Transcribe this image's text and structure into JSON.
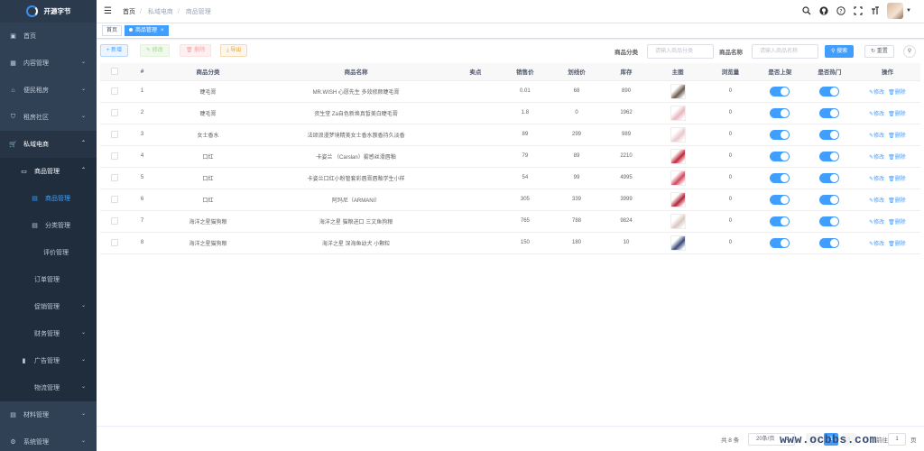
{
  "app": {
    "name": "开源字节"
  },
  "sidebar": {
    "items": [
      {
        "label": "首页",
        "icon": "dashboard-icon"
      },
      {
        "label": "内容管理",
        "icon": "grid-icon"
      },
      {
        "label": "便民租房",
        "icon": "home-icon"
      },
      {
        "label": "租房社区",
        "icon": "shield-icon"
      },
      {
        "label": "私域电商",
        "icon": "cart-icon"
      },
      {
        "label": "商品管理",
        "icon": "monitor-icon"
      },
      {
        "label": "商品管理",
        "icon": "table-icon"
      },
      {
        "label": "分类管理",
        "icon": "table-icon"
      },
      {
        "label": "评价管理",
        "icon": ""
      },
      {
        "label": "订单管理",
        "icon": ""
      },
      {
        "label": "促销管理",
        "icon": ""
      },
      {
        "label": "财务管理",
        "icon": ""
      },
      {
        "label": "广告管理",
        "icon": "bar-chart-icon"
      },
      {
        "label": "物流管理",
        "icon": ""
      },
      {
        "label": "材料管理",
        "icon": "doc-icon"
      },
      {
        "label": "系统管理",
        "icon": "gear-icon"
      }
    ]
  },
  "breadcrumb": [
    "首页",
    "私域电商",
    "商品管理"
  ],
  "tags": [
    {
      "label": "首页"
    },
    {
      "label": "商品管理"
    }
  ],
  "toolbar": {
    "add": "+ 新增",
    "edit": "✎ 修改",
    "delete": "🗑 删除",
    "export": "⤓ 导出"
  },
  "filters": {
    "category_label": "商品分类",
    "category_placeholder": "请输入商品分类",
    "name_label": "商品名称",
    "name_placeholder": "请输入商品名称",
    "search": "搜索",
    "reset": "重置"
  },
  "table": {
    "headers": [
      "",
      "#",
      "商品分类",
      "商品名称",
      "卖点",
      "销售价",
      "划线价",
      "库存",
      "主图",
      "浏览量",
      "是否上架",
      "是否热门",
      "操作"
    ],
    "rows": [
      {
        "idx": "1",
        "category": "睫毛膏",
        "name": "MR.WISH 心愿先生 多效修颜睫毛膏",
        "sell": "",
        "price": "0.01",
        "line_price": "68",
        "stock": "890",
        "views": "0",
        "on_sale": true,
        "hot": true,
        "thumb": "#6b5a4e"
      },
      {
        "idx": "2",
        "category": "睫毛膏",
        "name": "资生堂 Za自色新焕真皙美白睫毛膏",
        "sell": "",
        "price": "1.8",
        "line_price": "0",
        "stock": "1962",
        "views": "0",
        "on_sale": true,
        "hot": true,
        "thumb": "#e8b7c0"
      },
      {
        "idx": "3",
        "category": "女士香水",
        "name": "法颂浪漫梦境精美女士香水簇香持久淡香",
        "sell": "",
        "price": "89",
        "line_price": "299",
        "stock": "989",
        "views": "0",
        "on_sale": true,
        "hot": true,
        "thumb": "#e9c9cf"
      },
      {
        "idx": "4",
        "category": "口红",
        "name": "卡姿兰 （Carslan）雾感丝滑唇釉",
        "sell": "",
        "price": "79",
        "line_price": "89",
        "stock": "2210",
        "views": "0",
        "on_sale": true,
        "hot": true,
        "thumb": "#c0283a"
      },
      {
        "idx": "5",
        "category": "口红",
        "name": "卡姿兰口红小粉管套彩唇膏唇釉学生小样",
        "sell": "",
        "price": "54",
        "line_price": "99",
        "stock": "4995",
        "views": "0",
        "on_sale": true,
        "hot": true,
        "thumb": "#d1485d"
      },
      {
        "idx": "6",
        "category": "口红",
        "name": "阿玛尼（ARMANI）",
        "sell": "",
        "price": "305",
        "line_price": "339",
        "stock": "3999",
        "views": "0",
        "on_sale": true,
        "hot": true,
        "thumb": "#b3253a"
      },
      {
        "idx": "7",
        "category": "海洋之星猫狗粮",
        "name": "海洋之星 猫粮进口 三文鱼狗粮",
        "sell": "",
        "price": "765",
        "line_price": "788",
        "stock": "9824",
        "views": "0",
        "on_sale": true,
        "hot": true,
        "thumb": "#d9c7c0"
      },
      {
        "idx": "8",
        "category": "海洋之星猫狗粮",
        "name": "海洋之星 深海鱼幼犬 小颗粒",
        "sell": "",
        "price": "150",
        "line_price": "180",
        "stock": "10",
        "views": "0",
        "on_sale": true,
        "hot": true,
        "thumb": "#3b4a7a"
      }
    ],
    "op_edit": "✎修改",
    "op_delete": "🗑删除"
  },
  "pagination": {
    "total": "共 8 条",
    "page_size": "20条/页",
    "current": "1",
    "goto_label": "前往",
    "goto_value": "1",
    "page_suffix": "页"
  },
  "watermark": "www.ocbbs.com",
  "colors": {
    "primary": "#409eff",
    "sidebar": "#304156"
  }
}
